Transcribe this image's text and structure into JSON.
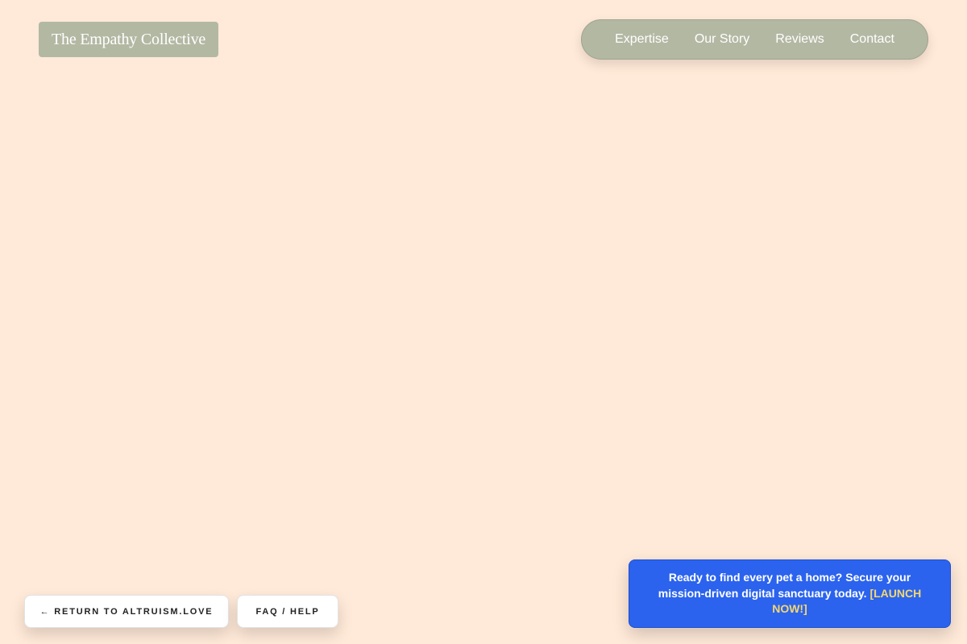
{
  "header": {
    "logo_text": "The Empathy Collective"
  },
  "nav": {
    "items": [
      {
        "label": "Expertise"
      },
      {
        "label": "Our Story"
      },
      {
        "label": "Reviews"
      },
      {
        "label": "Contact"
      }
    ]
  },
  "footer": {
    "return_label": "← RETURN TO ALTRUISM.LOVE",
    "faq_label": "FAQ / HELP"
  },
  "cta": {
    "text": "Ready to find every pet a home? Secure your mission-driven digital sanctuary today.",
    "link_label": "[LAUNCH NOW!]"
  },
  "colors": {
    "background": "#ffe9d8",
    "sage_accent": "#b3b8a3",
    "cta_blue": "#2b63ee",
    "cta_link_yellow": "#f5d76e"
  }
}
